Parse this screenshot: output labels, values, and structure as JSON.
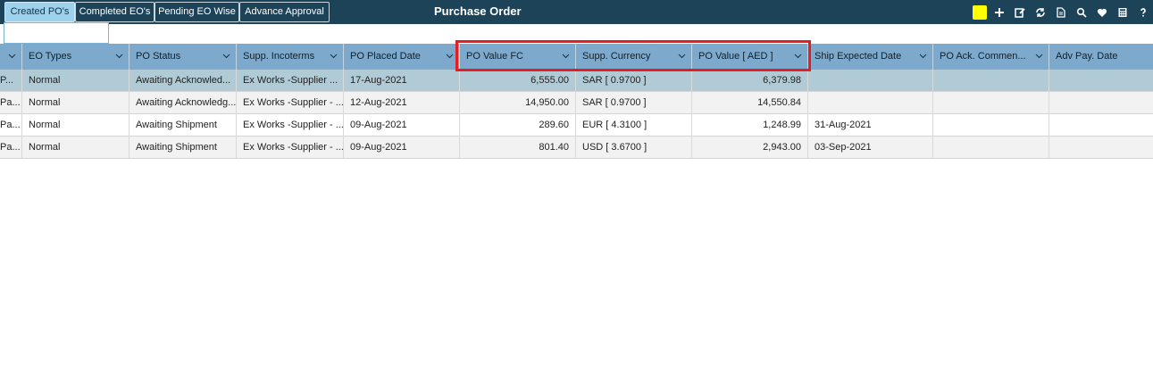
{
  "tabs": [
    {
      "label": "Created PO's",
      "active": true
    },
    {
      "label": "Completed EO's",
      "active": false
    },
    {
      "label": "Pending EO Wise",
      "active": false
    },
    {
      "label": "Advance Approval",
      "active": false
    }
  ],
  "page_title": "Purchase Order",
  "toolbar": {
    "swatch_color": "#ffff00",
    "icons": [
      "add-icon",
      "edit-icon",
      "refresh-icon",
      "document-icon",
      "search-icon",
      "heart-icon",
      "calculator-icon",
      "help-icon"
    ]
  },
  "columns": [
    {
      "label": ""
    },
    {
      "label": "EO Types"
    },
    {
      "label": "PO Status"
    },
    {
      "label": "Supp. Incoterms"
    },
    {
      "label": "PO Placed Date"
    },
    {
      "label": "PO Value FC"
    },
    {
      "label": "Supp. Currency"
    },
    {
      "label": "PO Value [ AED ]"
    },
    {
      "label": "Ship Expected Date"
    },
    {
      "label": "PO Ack. Commen..."
    },
    {
      "label": "Adv Pay. Date"
    }
  ],
  "rows": [
    {
      "selected": true,
      "cells": [
        "P...",
        "Normal",
        "Awaiting Acknowled...",
        "Ex Works -Supplier ...",
        "17-Aug-2021",
        "6,555.00",
        "SAR [ 0.9700 ]",
        "6,379.98",
        "",
        "",
        ""
      ]
    },
    {
      "selected": false,
      "cells": [
        "Pa...",
        "Normal",
        "Awaiting Acknowledg...",
        "Ex Works -Supplier - ...",
        "12-Aug-2021",
        "14,950.00",
        "SAR [ 0.9700 ]",
        "14,550.84",
        "",
        "",
        ""
      ]
    },
    {
      "selected": false,
      "cells": [
        "Pa...",
        "Normal",
        "Awaiting Shipment",
        "Ex Works -Supplier - ...",
        "09-Aug-2021",
        "289.60",
        "EUR [ 4.3100 ]",
        "1,248.99",
        "31-Aug-2021",
        "",
        ""
      ]
    },
    {
      "selected": false,
      "cells": [
        "Pa...",
        "Normal",
        "Awaiting Shipment",
        "Ex Works -Supplier - ...",
        "09-Aug-2021",
        "801.40",
        "USD [ 3.6700 ]",
        "2,943.00",
        "03-Sep-2021",
        "",
        ""
      ]
    }
  ],
  "highlight_color": "#e41e25"
}
